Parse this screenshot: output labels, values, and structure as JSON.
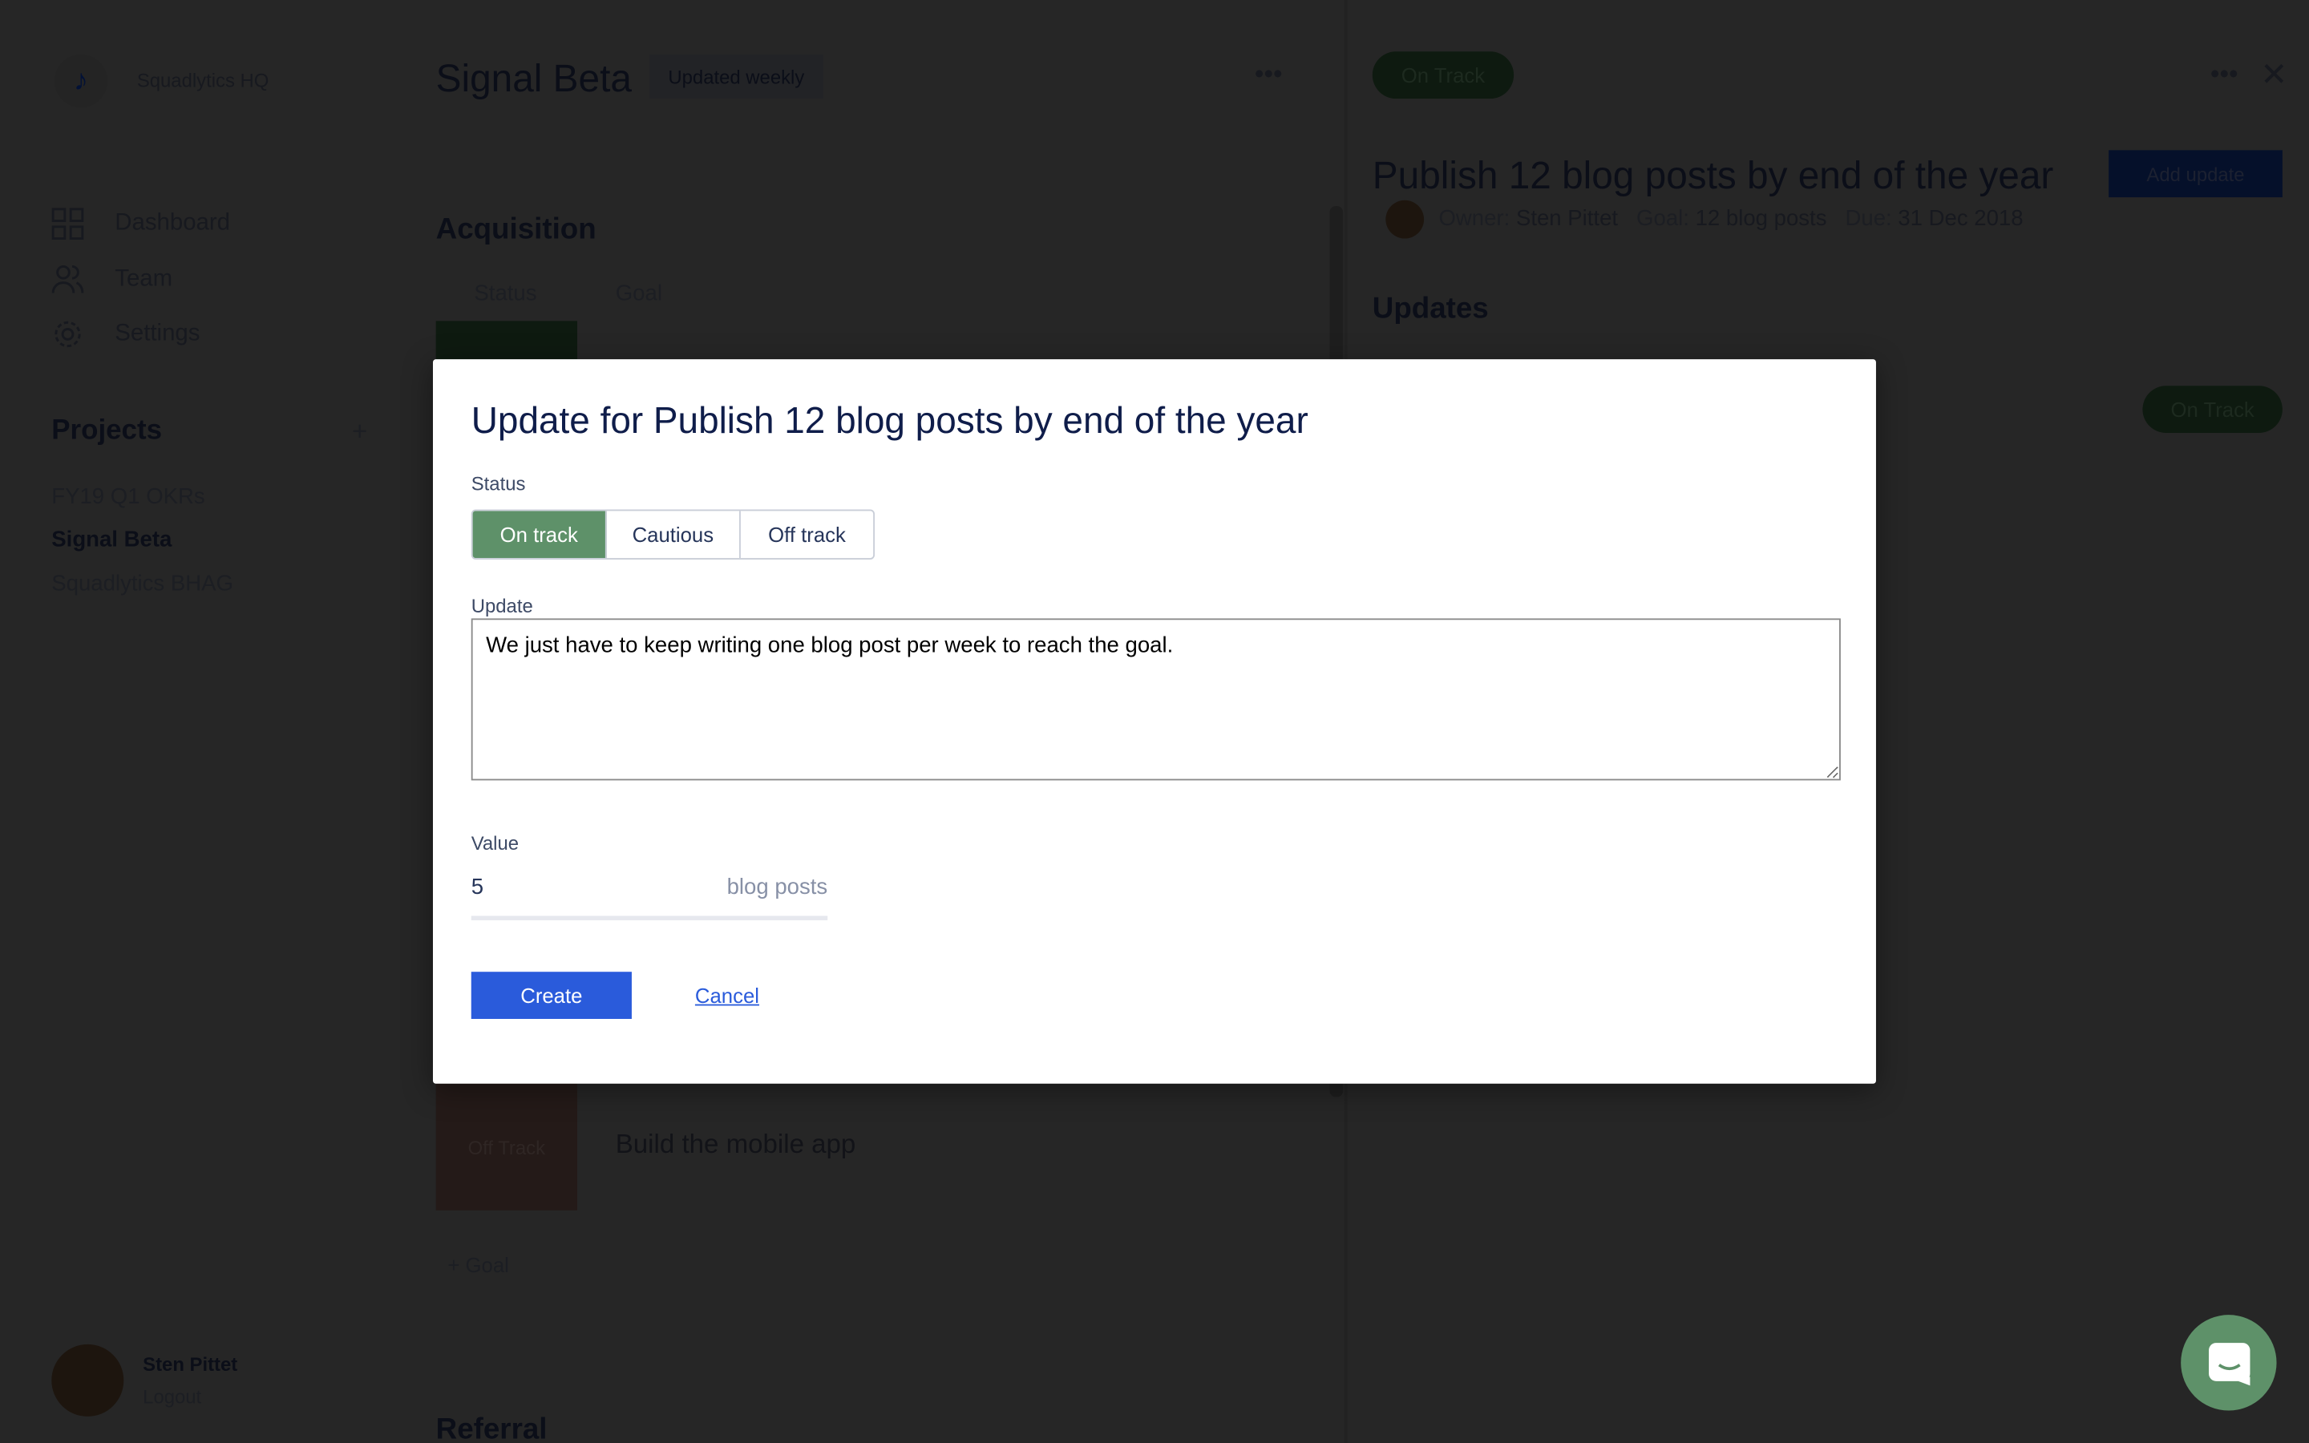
{
  "sidebar": {
    "org_name": "Squadlytics HQ",
    "nav": [
      {
        "label": "Dashboard",
        "icon": "grid-icon"
      },
      {
        "label": "Team",
        "icon": "users-icon"
      },
      {
        "label": "Settings",
        "icon": "gear-icon"
      }
    ],
    "projects_heading": "Projects",
    "projects": [
      "FY19 Q1 OKRs",
      "Signal Beta",
      "Squadlytics BHAG"
    ],
    "active_project": "Signal Beta",
    "user_name": "Sten Pittet",
    "logout": "Logout"
  },
  "main": {
    "title": "Signal Beta",
    "badge": "Updated weekly",
    "section": "Acquisition",
    "columns": [
      "Status",
      "Goal"
    ],
    "rows": [
      {
        "status": "Off Track",
        "goal": "Build the mobile app"
      }
    ],
    "add_goal": "+ Goal",
    "next_section": "Referral"
  },
  "panel": {
    "status": "On Track",
    "title": "Publish 12 blog posts by end of the year",
    "add_update": "Add update",
    "owner_label": "Owner:",
    "owner": "Sten Pittet",
    "goal_label": "Goal:",
    "goal": "12 blog posts",
    "due_label": "Due:",
    "due": "31 Dec 2018",
    "updates_heading": "Updates",
    "update_status": "On Track"
  },
  "modal": {
    "title": "Update for Publish 12 blog posts by end of the year",
    "status_label": "Status",
    "status_options": [
      "On track",
      "Cautious",
      "Off track"
    ],
    "selected_status": "On track",
    "update_label": "Update",
    "update_text": "We just have to keep writing one blog post per week to reach the goal.",
    "value_label": "Value",
    "value": "5",
    "value_unit": "blog posts",
    "create": "Create",
    "cancel": "Cancel"
  },
  "colors": {
    "on_track": "#5e9169",
    "off_track": "#c0544a",
    "primary": "#2a5bdb",
    "brand": "#0f2e7a"
  }
}
